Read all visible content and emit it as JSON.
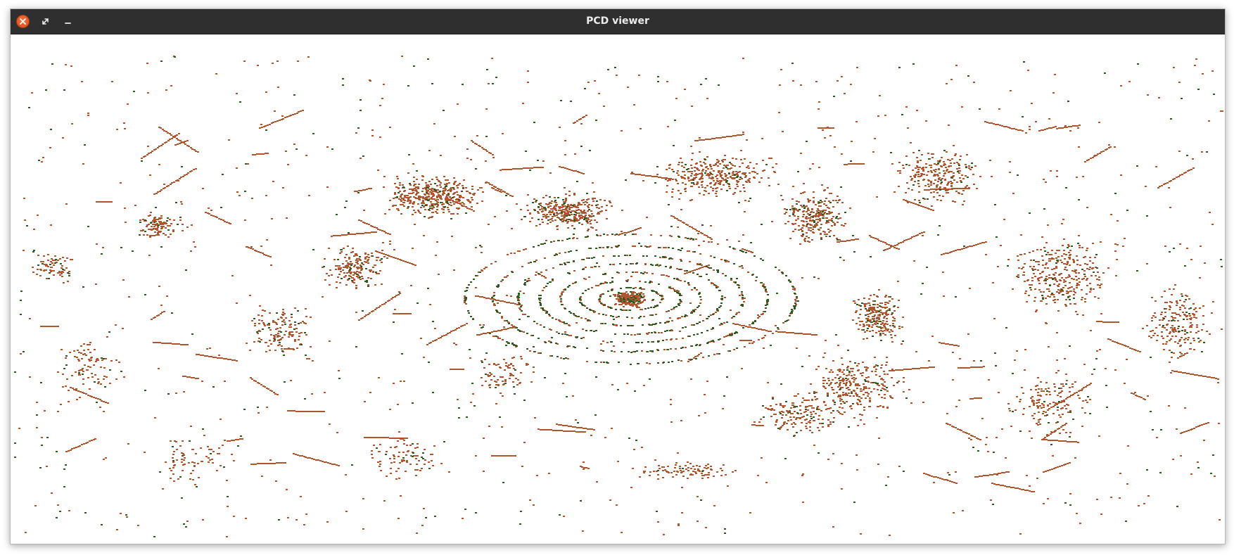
{
  "window": {
    "title": "PCD viewer"
  },
  "controls": {
    "close_icon": "close-icon",
    "maximize_icon": "maximize-icon",
    "minimize_icon": "minimize-icon"
  },
  "colors": {
    "titlebar": "#2f2f2f",
    "title_text": "#ececec",
    "close_button": "#e9561f",
    "background": "#ffffff",
    "point_primary": "#b0562f",
    "point_secondary": "#2f5a1f"
  }
}
